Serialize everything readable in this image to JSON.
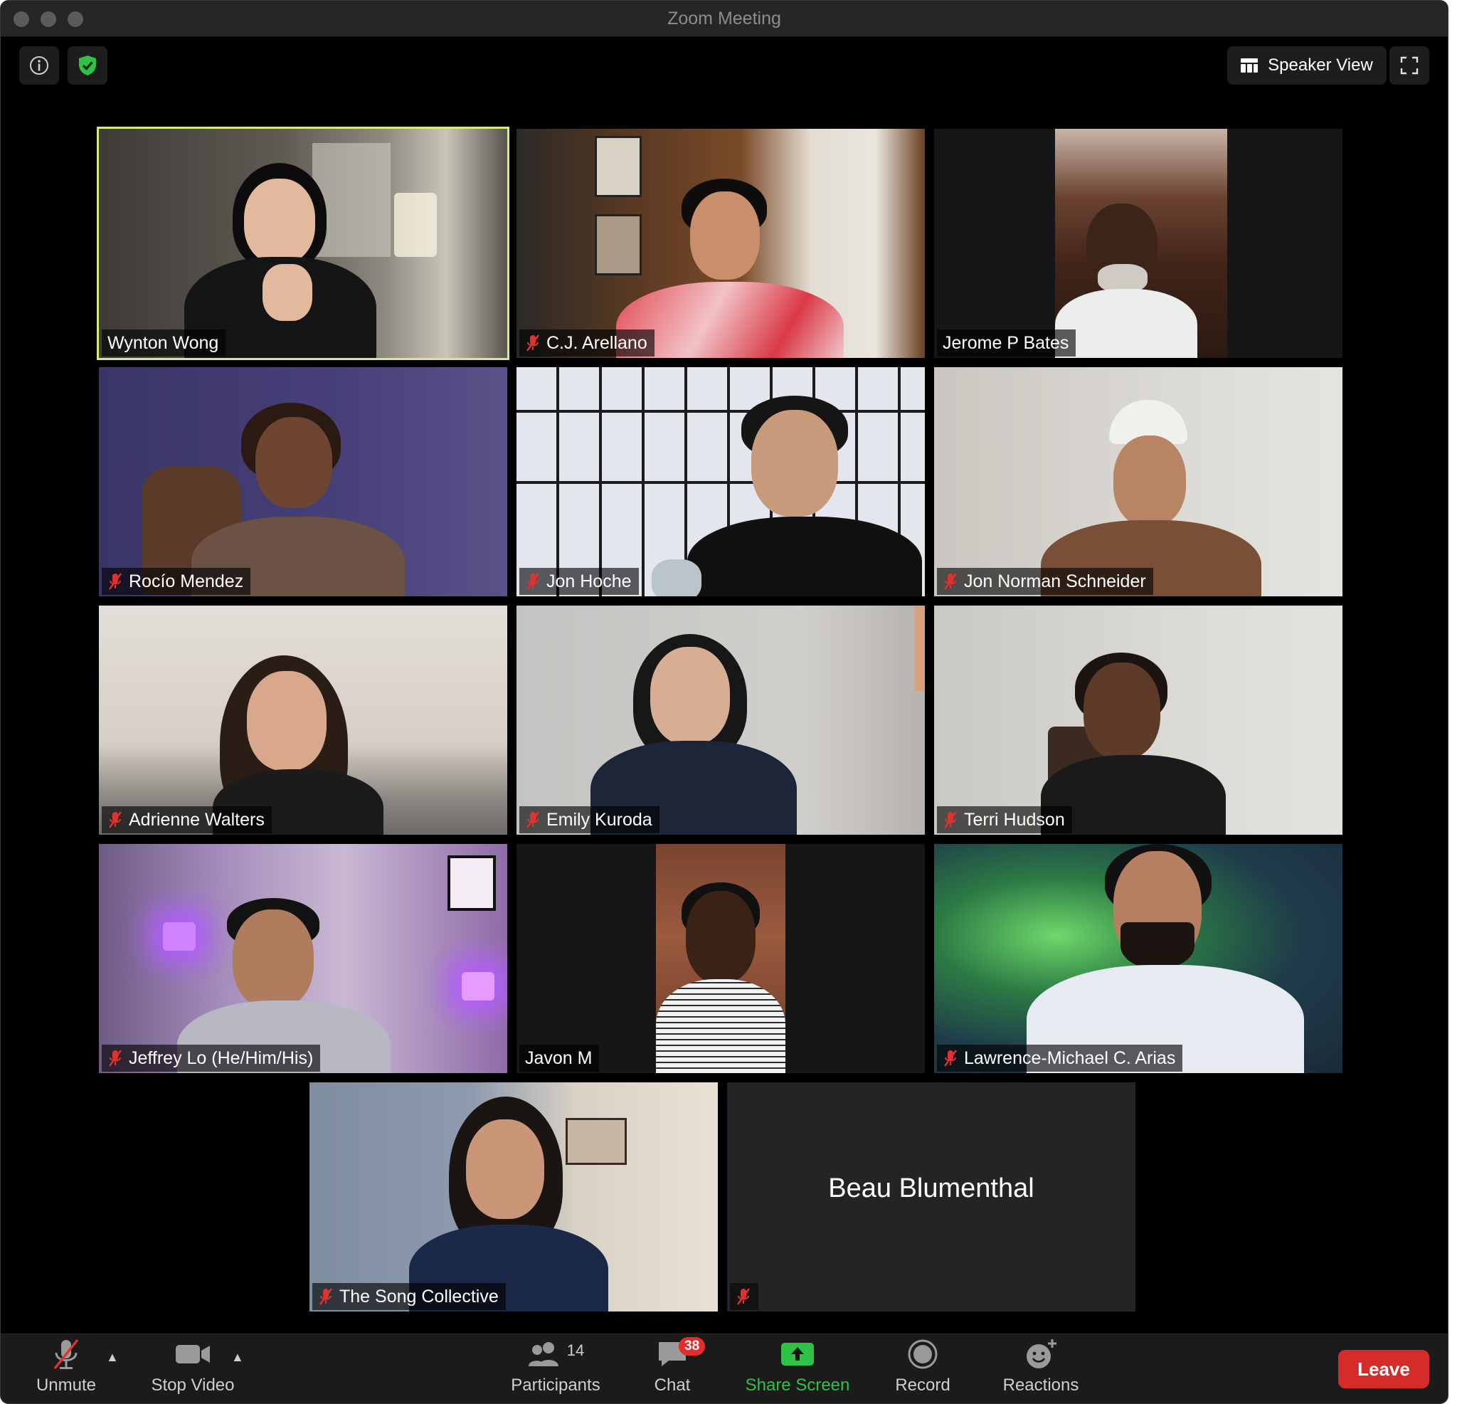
{
  "window": {
    "title": "Zoom Meeting"
  },
  "top_bar": {
    "speaker_view_label": "Speaker View"
  },
  "participants": [
    {
      "name": "Wynton Wong",
      "muted": false,
      "active_speaker": true,
      "bg": "#4d4a44"
    },
    {
      "name": "C.J. Arellano",
      "muted": true,
      "bg": "#7a5030"
    },
    {
      "name": "Jerome P Bates",
      "muted": false,
      "bg": "#151515"
    },
    {
      "name": "Rocío Mendez",
      "muted": true,
      "bg": "#423c6c"
    },
    {
      "name": "Jon Hoche",
      "muted": true,
      "bg": "#d7d9e3"
    },
    {
      "name": "Jon Norman Schneider",
      "muted": true,
      "bg": "#d3d1cb"
    },
    {
      "name": "Adrienne Walters",
      "muted": true,
      "bg": "#d6cec6"
    },
    {
      "name": "Emily Kuroda",
      "muted": true,
      "bg": "#c9c7c6"
    },
    {
      "name": "Terri Hudson",
      "muted": true,
      "bg": "#cfccc7"
    },
    {
      "name": "Jeffrey Lo (He/Him/His)",
      "muted": true,
      "bg": "#8f7aa4"
    },
    {
      "name": "Javon M",
      "muted": false,
      "bg": "#161616"
    },
    {
      "name": "Lawrence-Michael C. Arias",
      "muted": true,
      "bg": "#2f5c3a"
    },
    {
      "name": "The Song Collective",
      "muted": true,
      "bg": "#bfb7ab"
    },
    {
      "name": "Beau Blumenthal",
      "muted": true,
      "video_off": true,
      "bg": "#242424"
    }
  ],
  "toolbar": {
    "unmute_label": "Unmute",
    "stop_video_label": "Stop Video",
    "participants_label": "Participants",
    "participants_count": "14",
    "chat_label": "Chat",
    "chat_unread": "38",
    "share_screen_label": "Share Screen",
    "record_label": "Record",
    "reactions_label": "Reactions",
    "leave_label": "Leave"
  },
  "colors": {
    "active_speaker_border": "#d7ea7d",
    "share_screen_green": "#2fc246",
    "leave_red": "#d62b2b",
    "mute_red": "#e0322e",
    "shield_green": "#2fc246"
  }
}
